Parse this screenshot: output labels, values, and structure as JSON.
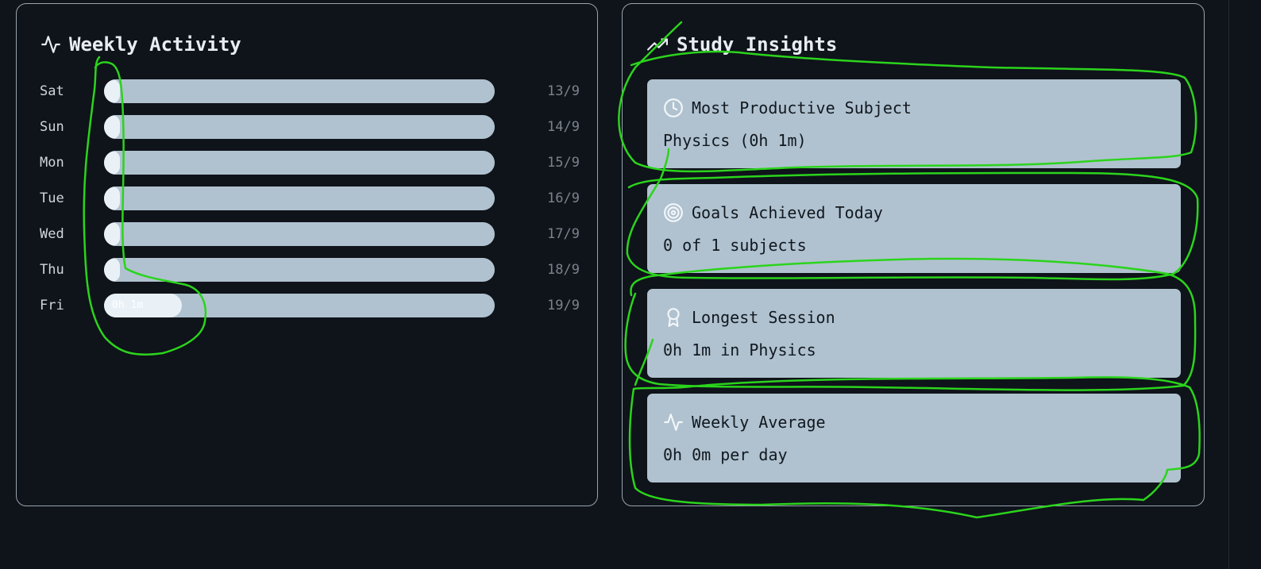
{
  "weekly": {
    "title": "Weekly Activity",
    "title_icon": "activity-icon",
    "days": [
      {
        "day": "Sat",
        "date": "13/9",
        "fill_fraction": 0.04,
        "label": ""
      },
      {
        "day": "Sun",
        "date": "14/9",
        "fill_fraction": 0.04,
        "label": ""
      },
      {
        "day": "Mon",
        "date": "15/9",
        "fill_fraction": 0.04,
        "label": ""
      },
      {
        "day": "Tue",
        "date": "16/9",
        "fill_fraction": 0.04,
        "label": ""
      },
      {
        "day": "Wed",
        "date": "17/9",
        "fill_fraction": 0.04,
        "label": ""
      },
      {
        "day": "Thu",
        "date": "18/9",
        "fill_fraction": 0.04,
        "label": ""
      },
      {
        "day": "Fri",
        "date": "19/9",
        "fill_fraction": 0.2,
        "label": "0h 1m"
      }
    ]
  },
  "insights": {
    "title": "Study Insights",
    "title_icon": "trending-up-icon",
    "cards": [
      {
        "icon": "clock-icon",
        "heading": "Most Productive Subject",
        "value": "Physics (0h 1m)"
      },
      {
        "icon": "target-icon",
        "heading": "Goals Achieved Today",
        "value": "0 of 1 subjects"
      },
      {
        "icon": "award-icon",
        "heading": "Longest Session",
        "value": "0h 1m in Physics"
      },
      {
        "icon": "activity-icon",
        "heading": "Weekly Average",
        "value": "0h 0m per day"
      }
    ]
  },
  "colors": {
    "background": "#0f131a",
    "card": "#b0c2cf",
    "bar_fill": "#e9f1f7",
    "annotation": "#2bd41c"
  }
}
